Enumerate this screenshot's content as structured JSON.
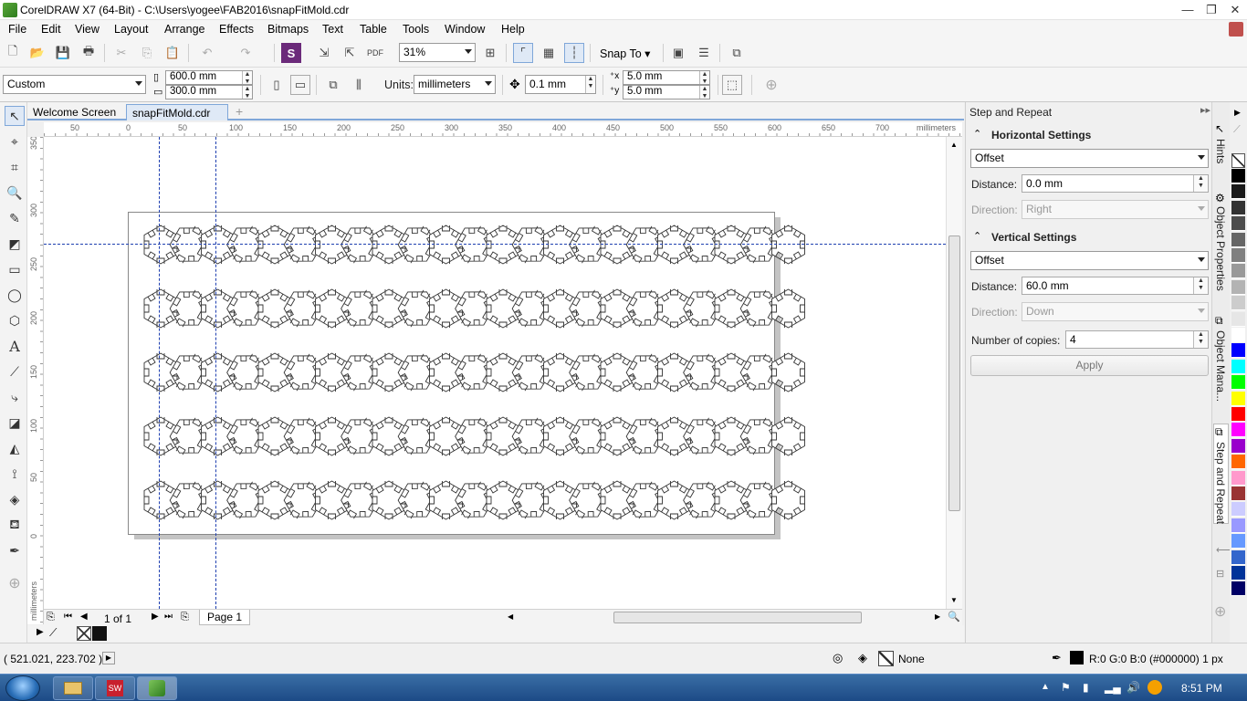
{
  "window": {
    "title": "CorelDRAW X7 (64-Bit) - C:\\Users\\yogee\\FAB2016\\snapFitMold.cdr"
  },
  "menu": [
    "File",
    "Edit",
    "View",
    "Layout",
    "Arrange",
    "Effects",
    "Bitmaps",
    "Text",
    "Table",
    "Tools",
    "Window",
    "Help"
  ],
  "toolbar": {
    "zoom": "31%",
    "snap_to": "Snap To"
  },
  "propbar": {
    "page_preset": "Custom",
    "width": "600.0 mm",
    "height": "300.0 mm",
    "units_label": "Units:",
    "units": "millimeters",
    "nudge": "0.1 mm",
    "dup_x": "5.0 mm",
    "dup_y": "5.0 mm"
  },
  "tabs": [
    "Welcome Screen",
    "snapFitMold.cdr",
    "+"
  ],
  "ruler": {
    "h_ticks": [
      "50",
      "0",
      "50",
      "100",
      "150",
      "200",
      "250",
      "300",
      "350",
      "400",
      "450",
      "500",
      "550",
      "600",
      "650",
      "700"
    ],
    "unit": "millimeters",
    "v_ticks": [
      "350",
      "300",
      "250",
      "200",
      "150",
      "100",
      "50",
      "0"
    ]
  },
  "pagenav": {
    "count": "1 of 1",
    "page": "Page 1"
  },
  "docker": {
    "title": "Step and Repeat",
    "horizontal": {
      "heading": "Horizontal Settings",
      "mode": "Offset",
      "distance_label": "Distance:",
      "distance": "0.0 mm",
      "direction_label": "Direction:",
      "direction": "Right"
    },
    "vertical": {
      "heading": "Vertical Settings",
      "mode": "Offset",
      "distance_label": "Distance:",
      "distance": "60.0 mm",
      "direction_label": "Direction:",
      "direction": "Down"
    },
    "copies_label": "Number of copies:",
    "copies": "4",
    "apply": "Apply"
  },
  "docker_tabs": [
    "Hints",
    "Object Properties",
    "Object Mana...",
    "Step and Repeat"
  ],
  "palette": [
    "#000000",
    "#1a1a1a",
    "#333333",
    "#4d4d4d",
    "#666666",
    "#808080",
    "#999999",
    "#b3b3b3",
    "#cccccc",
    "#e6e6e6",
    "#ffffff",
    "#0000ff",
    "#00ffff",
    "#00ff00",
    "#ffff00",
    "#ff0000",
    "#ff00ff",
    "#9900cc",
    "#ff6600",
    "#ff99cc",
    "#993333",
    "#ccccff",
    "#9999ff",
    "#6699ff",
    "#3366cc",
    "#003399",
    "#000066"
  ],
  "status": {
    "coords": "( 521.021, 223.702 )",
    "fill": "None",
    "outline": "R:0 G:0 B:0 (#000000)  1 px"
  },
  "taskbar": {
    "time": "8:51 PM"
  }
}
